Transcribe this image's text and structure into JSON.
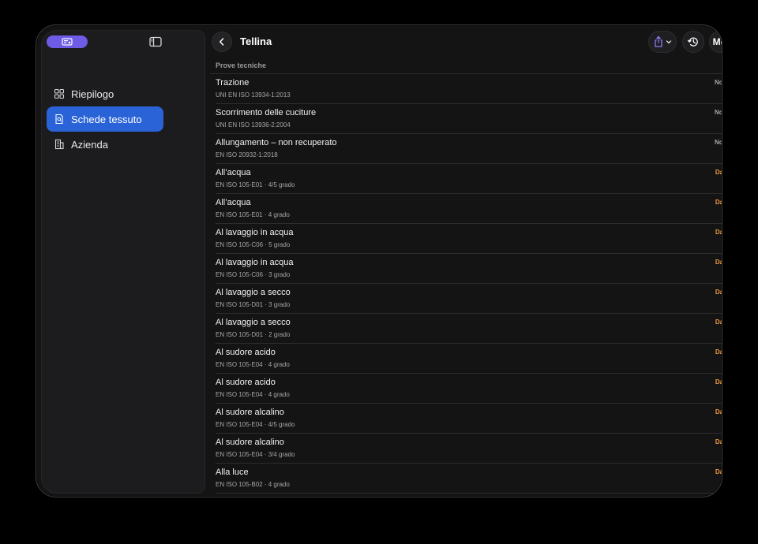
{
  "app": {
    "accent": "#6e5ce6",
    "selected_color": "#2a63d8",
    "pending_color": "#f29a3d"
  },
  "sidebar": {
    "items": [
      {
        "label": "Riepilogo",
        "icon": "grid-icon",
        "active": false
      },
      {
        "label": "Schede tessuto",
        "icon": "document-search-icon",
        "active": true
      },
      {
        "label": "Azienda",
        "icon": "building-icon",
        "active": false
      }
    ]
  },
  "header": {
    "title": "Tellina",
    "edit_label": "Modifica"
  },
  "section": {
    "label": "Prove tecniche"
  },
  "rows": [
    {
      "title": "Trazione",
      "sub": "UNI EN ISO 13934-1:2013",
      "status": "Non testato",
      "kind": "none"
    },
    {
      "title": "Scorrimento delle cuciture",
      "sub": "UNI EN ISO 13936-2:2004",
      "status": "Non testato",
      "kind": "none"
    },
    {
      "title": "Allungamento – non recuperato",
      "sub": "EN ISO 20932-1:2018",
      "status": "Non testato",
      "kind": "none"
    },
    {
      "title": "All’acqua",
      "sub": "EN ISO 105-E01 · 4/5 grado",
      "status": "Da valutare",
      "kind": "eval"
    },
    {
      "title": "All’acqua",
      "sub": "EN ISO 105-E01 · 4 grado",
      "status": "Da valutare",
      "kind": "eval"
    },
    {
      "title": "Al lavaggio in acqua",
      "sub": "EN ISO 105-C06 · 5 grado",
      "status": "Da valutare",
      "kind": "eval"
    },
    {
      "title": "Al lavaggio in acqua",
      "sub": "EN ISO 105-C06 · 3 grado",
      "status": "Da valutare",
      "kind": "eval"
    },
    {
      "title": "Al lavaggio a secco",
      "sub": "EN ISO 105-D01 · 3 grado",
      "status": "Da valutare",
      "kind": "eval"
    },
    {
      "title": "Al lavaggio a secco",
      "sub": "EN ISO 105-D01 · 2 grado",
      "status": "Da valutare",
      "kind": "eval"
    },
    {
      "title": "Al sudore acido",
      "sub": "EN ISO 105-E04 · 4 grado",
      "status": "Da valutare",
      "kind": "eval"
    },
    {
      "title": "Al sudore acido",
      "sub": "EN ISO 105-E04 · 4 grado",
      "status": "Da valutare",
      "kind": "eval"
    },
    {
      "title": "Al sudore alcalino",
      "sub": "EN ISO 105-E04 · 4/5 grado",
      "status": "Da valutare",
      "kind": "eval"
    },
    {
      "title": "Al sudore alcalino",
      "sub": "EN ISO 105-E04 · 3/4 grado",
      "status": "Da valutare",
      "kind": "eval"
    },
    {
      "title": "Alla luce",
      "sub": "EN ISO 105-B02 · 4 grado",
      "status": "Da valutare",
      "kind": "eval"
    }
  ]
}
